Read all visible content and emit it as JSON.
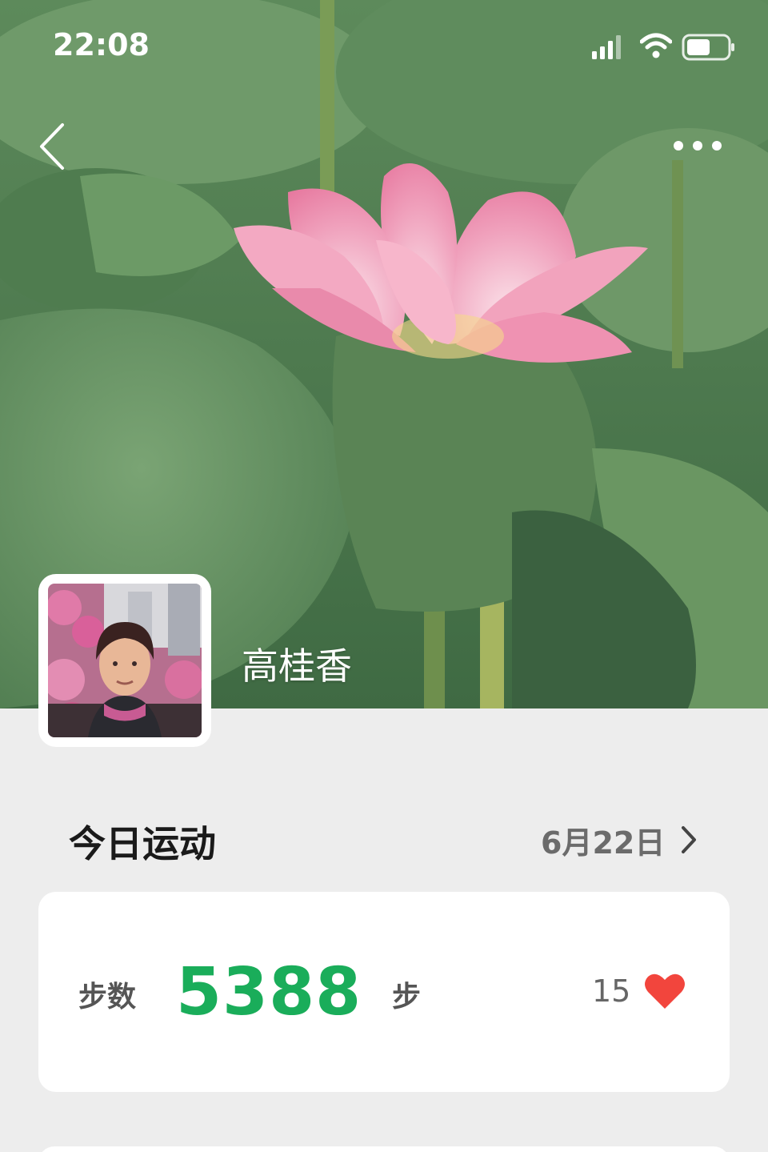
{
  "status_bar": {
    "time": "22:08",
    "icons": [
      "signal-icon",
      "wifi-icon",
      "battery-icon"
    ]
  },
  "nav": {
    "back_icon": "chevron-left-icon",
    "more_icon": "more-dots-icon"
  },
  "profile": {
    "name": "高桂香",
    "cover_image": "pink lotus flower among green leaves",
    "avatar_image": "portrait with blossoms"
  },
  "today": {
    "title": "今日运动",
    "date": "6月22日",
    "date_icon": "chevron-right-icon"
  },
  "steps_card": {
    "label": "步数",
    "value": "5388",
    "unit": "步",
    "likes": "15",
    "like_icon": "heart-icon"
  },
  "colors": {
    "accent_green": "#1aad5a",
    "heart_red": "#f2453d",
    "background": "#ededed",
    "card": "#ffffff"
  }
}
